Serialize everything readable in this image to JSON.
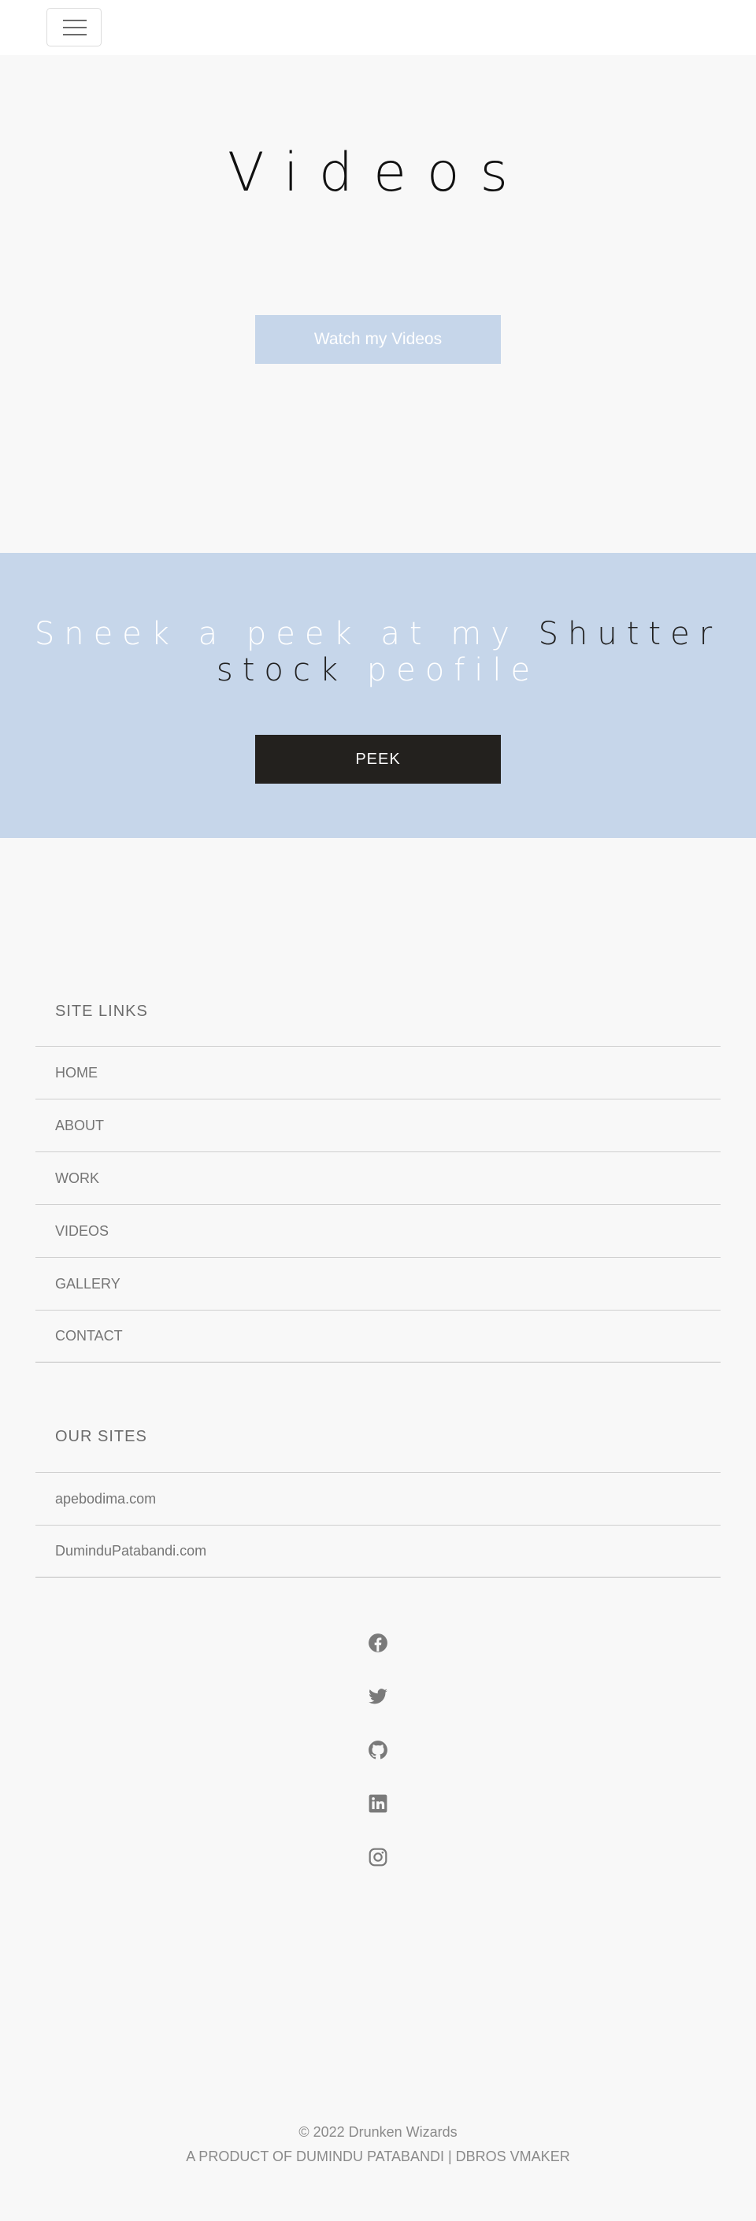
{
  "navbar": {
    "toggle_icon": "hamburger-menu-icon"
  },
  "hero": {
    "title": "Videos",
    "button_label": "Watch my Videos"
  },
  "peek": {
    "text_light": "Sneek a peek at my ",
    "text_dark": "Shutter stock",
    "text_light_end": " peofile",
    "button_label": "PEEK"
  },
  "site_links": {
    "title": "SITE LINKS",
    "items": [
      "HOME",
      "ABOUT",
      "WORK",
      "VIDEOS",
      "GALLERY",
      "CONTACT"
    ]
  },
  "our_sites": {
    "title": "OUR SITES",
    "items": [
      "apebodima.com",
      "DuminduPatabandi.com"
    ]
  },
  "socials": [
    "facebook-icon",
    "twitter-icon",
    "github-icon",
    "linkedin-icon",
    "instagram-icon"
  ],
  "footer": {
    "copyright": "© 2022 Drunken Wizards",
    "credit": "A PRODUCT OF DUMINDU PATABANDI | DBROS VMAKER"
  },
  "colors": {
    "accent_blue": "#c6d6ea",
    "dark_button": "#23211e",
    "page_bg": "#f8f8f8",
    "icon_gray": "#7a7a7a"
  }
}
